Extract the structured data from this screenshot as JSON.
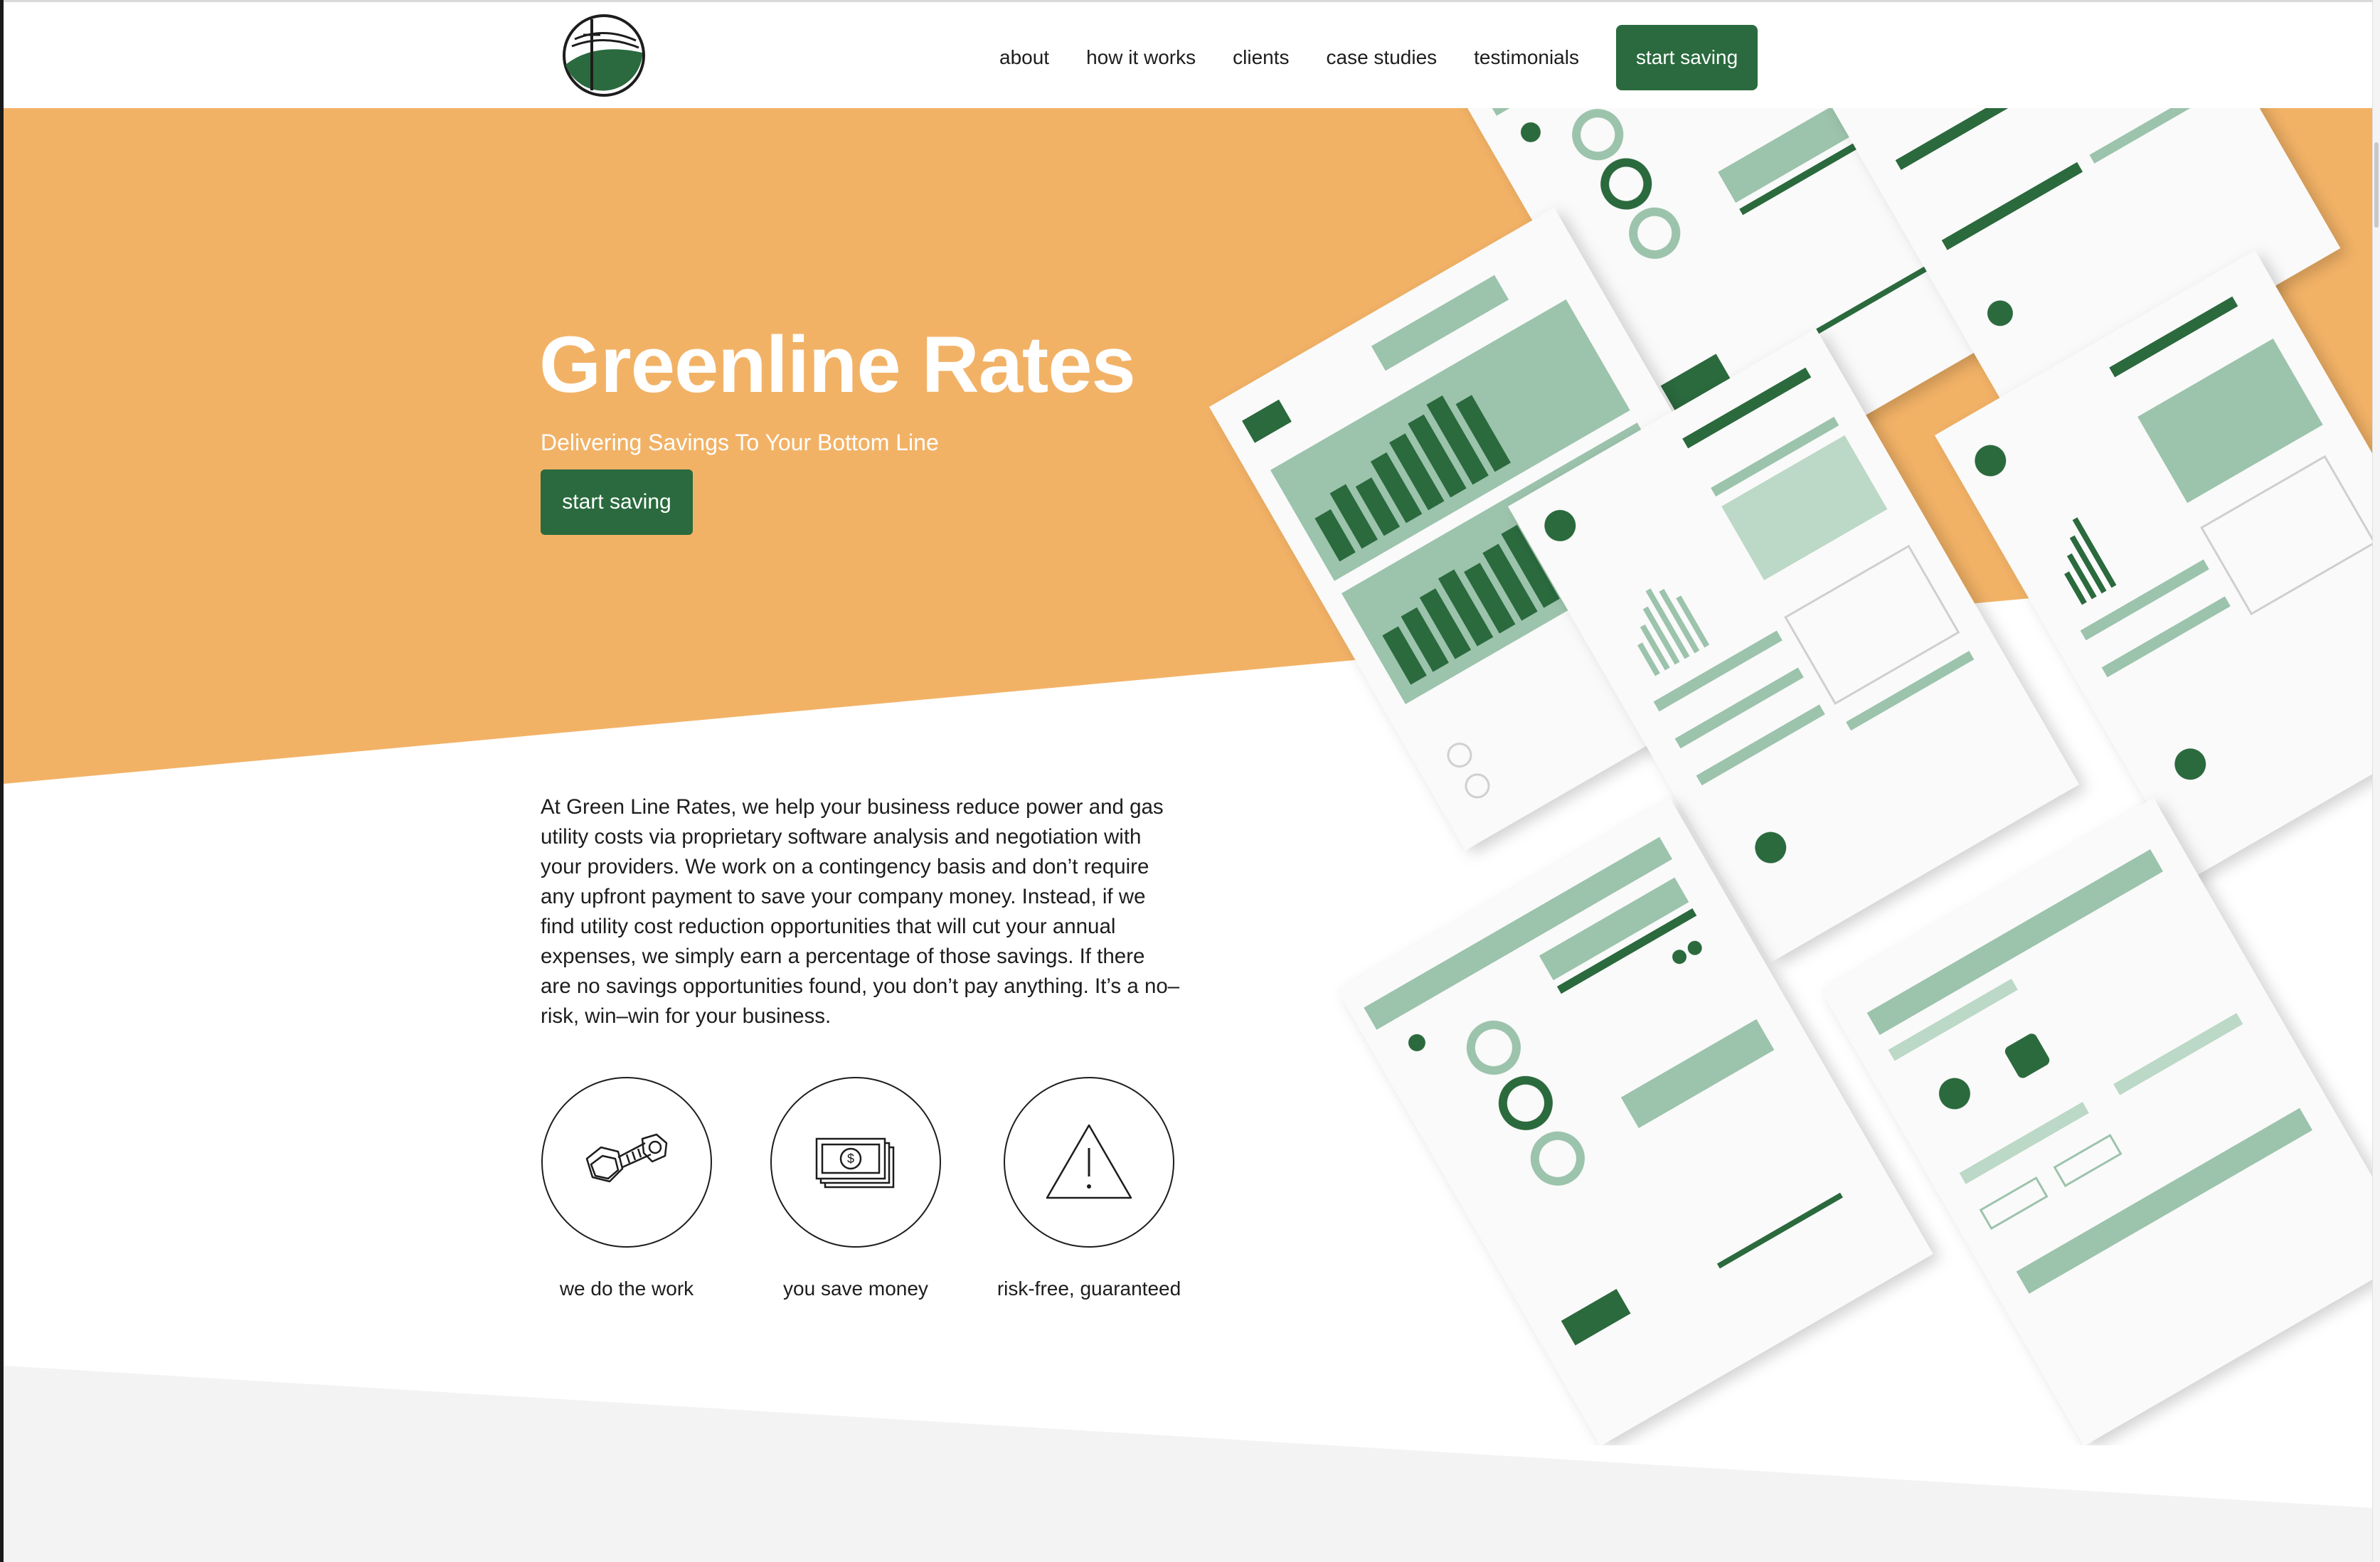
{
  "nav": {
    "logo_icon": "power-line-hill-logo",
    "links": [
      {
        "label": "about"
      },
      {
        "label": "how it works"
      },
      {
        "label": "clients"
      },
      {
        "label": "case studies"
      },
      {
        "label": "testimonials"
      }
    ],
    "cta_label": "start saving"
  },
  "hero": {
    "title": "Greenline Rates",
    "subtitle": "Delivering Savings To Your Bottom Line",
    "cta_label": "start saving"
  },
  "about": {
    "paragraph": "At Green Line Rates, we help your business reduce power and gas utility costs via proprietary software analysis and negotiation with your providers.  We work on a contingency basis and don’t require any upfront payment to save your company money.  Instead, if we find utility cost reduction opportunities that will cut your annual expenses, we simply earn a percentage of those savings.  If there are no savings opportunities found, you don’t pay anything.  It’s a no–risk, win–win for your business."
  },
  "features": [
    {
      "label": "we do the work",
      "icon": "bolt-nut-icon"
    },
    {
      "label": "you save money",
      "icon": "money-stack-icon"
    },
    {
      "label": "risk-free, guaranteed",
      "icon": "warning-triangle-icon"
    }
  ],
  "colors": {
    "brand_green": "#2a6a3e",
    "light_green": "#9cc3ac",
    "orange": "#f2b266",
    "gray_band": "#f3f3f3"
  }
}
